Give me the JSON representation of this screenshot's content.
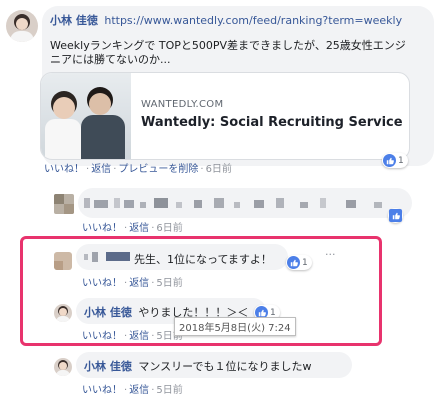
{
  "post": {
    "author": "小林 佳徳",
    "url": "https://www.wantedly.com/feed/ranking?term=weekly",
    "text_line1": "Weeklyランキングで TOPと500PV差まできましたが、25歳女性エンジ",
    "text_line2": "ニアには勝てないのか...",
    "card_domain": "WANTEDLY.COM",
    "card_title": "Wantedly: Social Recruiting Service",
    "like_label": "いいね！",
    "reply_label": "返信",
    "remove_preview_label": "プレビューを削除",
    "time": "6日前",
    "like_count": "1"
  },
  "comment1": {
    "like_label": "いいね！",
    "reply_label": "返信",
    "time": "6日前"
  },
  "comment2": {
    "text": "先生、1位になってますよ！",
    "like_count": "1",
    "more_label": "···",
    "like_label": "いいね！",
    "reply_label": "返信",
    "time": "5日前"
  },
  "comment3": {
    "author": "小林 佳徳",
    "text": "やりました！！！＞＜",
    "like_count": "1",
    "like_label": "いいね！",
    "reply_label": "返信",
    "time": "5日前",
    "tooltip": "2018年5月8日(火) 7:24"
  },
  "comment4": {
    "author": "小林 佳徳",
    "text": "マンスリーでも１位になりましたw",
    "like_label": "いいね！",
    "reply_label": "返信",
    "time": "5日前"
  },
  "colors": {
    "highlight_border": "#e8336d",
    "link_blue": "#385898",
    "like_blue": "#4c7fe8"
  }
}
